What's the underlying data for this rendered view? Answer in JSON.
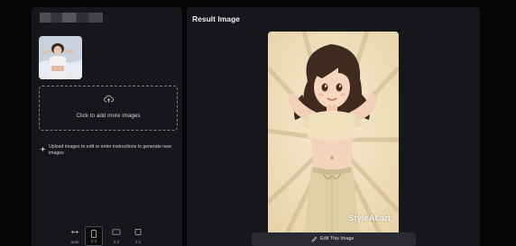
{
  "left_panel": {
    "upload": {
      "text": "Click to add more images",
      "icon": "upload-icon"
    },
    "hint": {
      "text": "Upload images to edit or enter instructions to generate new images",
      "icon": "sparkle-icon"
    },
    "aspect_ratios": [
      {
        "label": "auto",
        "icon": "expand-horizontal-icon",
        "selected": false
      },
      {
        "label": "2:3",
        "icon": "portrait-rect-icon",
        "selected": true
      },
      {
        "label": "3:2",
        "icon": "landscape-rect-icon",
        "selected": false
      },
      {
        "label": "1:1",
        "icon": "square-icon",
        "selected": false
      }
    ]
  },
  "right_panel": {
    "title": "Result Image",
    "watermark": "StyleAI.art",
    "edit_button_label": "Edit This Image",
    "edit_icon": "pencil-icon"
  },
  "colors": {
    "background": "#050506",
    "panel": "#16171b",
    "button": "#2a2b30",
    "image_bg": "#f1e5c8"
  }
}
